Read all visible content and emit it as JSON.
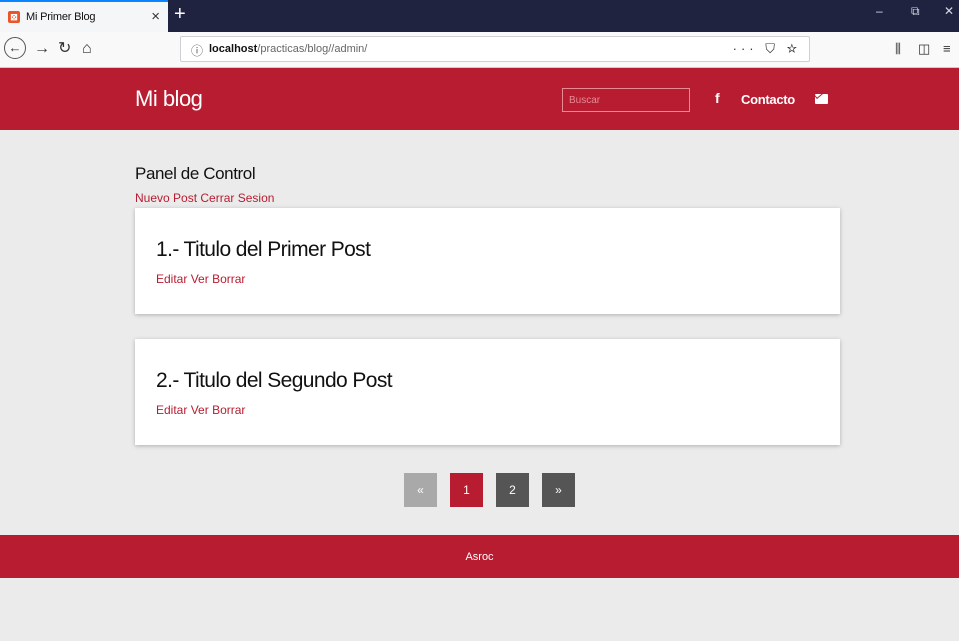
{
  "browser": {
    "tab_title": "Mi Primer Blog",
    "tab_close": "×",
    "new_tab": "+",
    "url_host": "localhost",
    "url_path": "/practicas/blog//admin/",
    "url_actions": "··· ⛉ ☆",
    "window_controls": [
      "–",
      "⧉",
      "✕"
    ]
  },
  "header": {
    "logo": "Mi blog",
    "search_placeholder": "Buscar",
    "facebook": "f",
    "contact": "Contacto"
  },
  "panel": {
    "title": "Panel de Control",
    "new_post": "Nuevo Post",
    "logout": "Cerrar Sesion"
  },
  "posts": [
    {
      "title": "1.- Titulo del Primer Post",
      "edit": "Editar",
      "view": "Ver",
      "delete": "Borrar"
    },
    {
      "title": "2.- Titulo del Segundo Post",
      "edit": "Editar",
      "view": "Ver",
      "delete": "Borrar"
    }
  ],
  "pagination": {
    "prev": "«",
    "pages": [
      "1",
      "2"
    ],
    "active_page": "1",
    "next": "»"
  },
  "footer": {
    "text": "Asroc"
  },
  "colors": {
    "brand_red": "#b71c30",
    "page_bg": "#ebebeb",
    "tabbar": "#202340"
  }
}
